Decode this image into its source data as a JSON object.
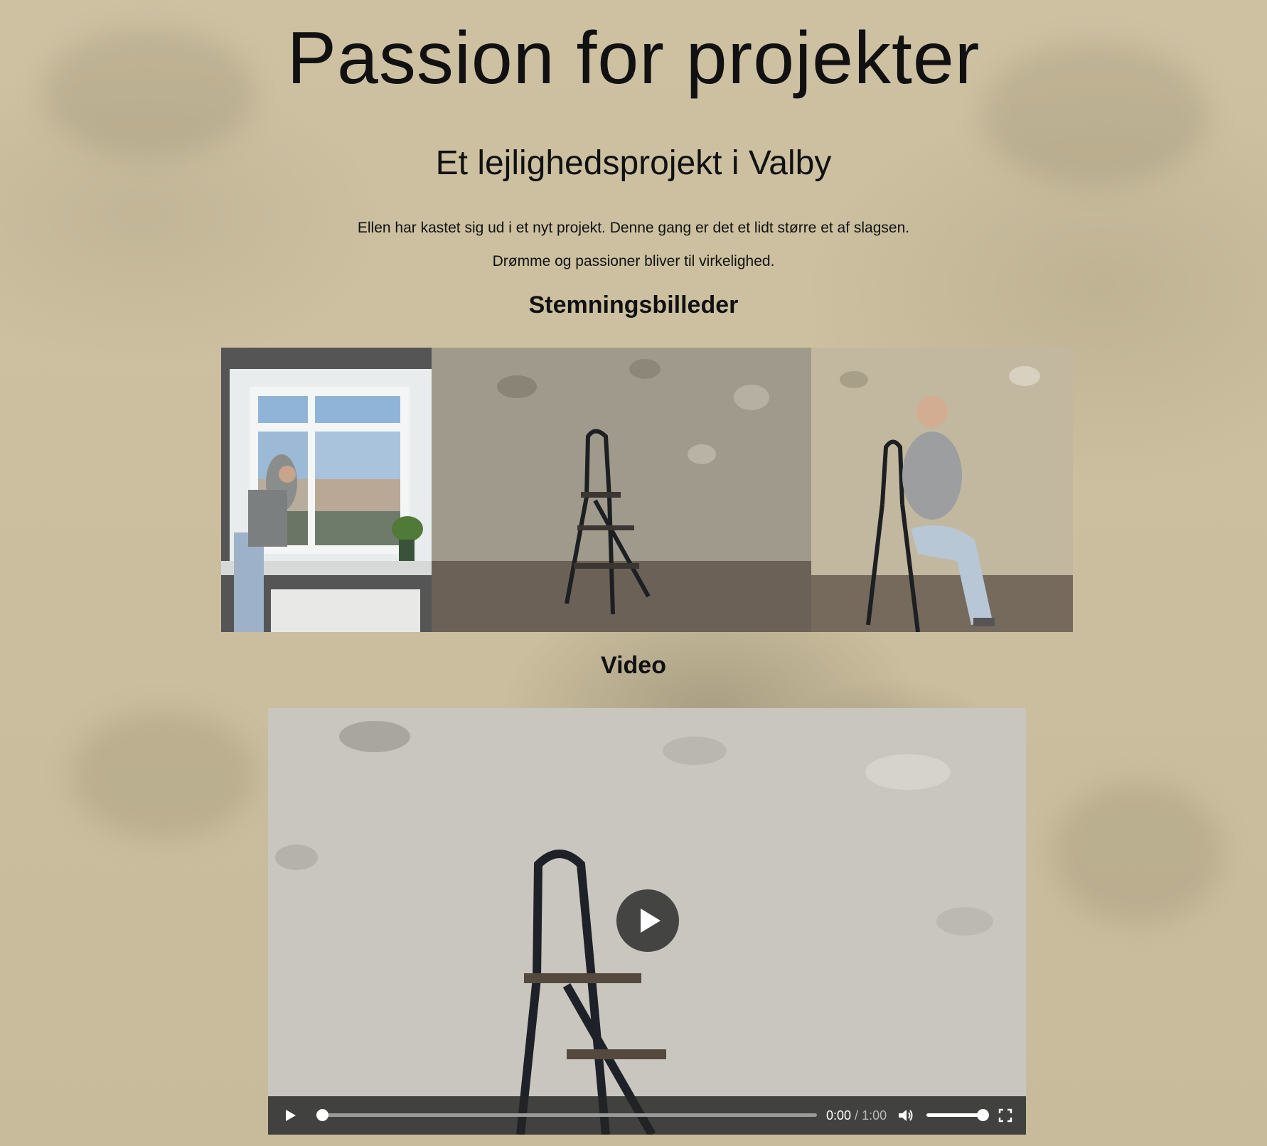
{
  "page": {
    "title": "Passion for projekter",
    "subtitle": "Et lejlighedsprojekt i Valby",
    "paragraphs": [
      "Ellen har kastet sig ud i et nyt projekt. Denne gang er det et lidt større et af slagsen.",
      "Drømme og passioner bliver til virkelighed."
    ]
  },
  "gallery": {
    "heading": "Stemningsbilleder",
    "images": [
      {
        "name": "woman-at-window-photo"
      },
      {
        "name": "ladder-photo"
      },
      {
        "name": "woman-on-ladder-photo"
      }
    ]
  },
  "video": {
    "heading": "Video",
    "current_time": "0:00",
    "separator": " / ",
    "duration": "1:00",
    "progress": 0,
    "volume": 1.0,
    "icons": {
      "big_play": "play-icon",
      "play": "play-icon",
      "volume": "volume-icon",
      "fullscreen": "fullscreen-icon"
    }
  },
  "colors": {
    "background": "#cbbf9f",
    "text": "#111111",
    "controls_bar": "#232323"
  }
}
